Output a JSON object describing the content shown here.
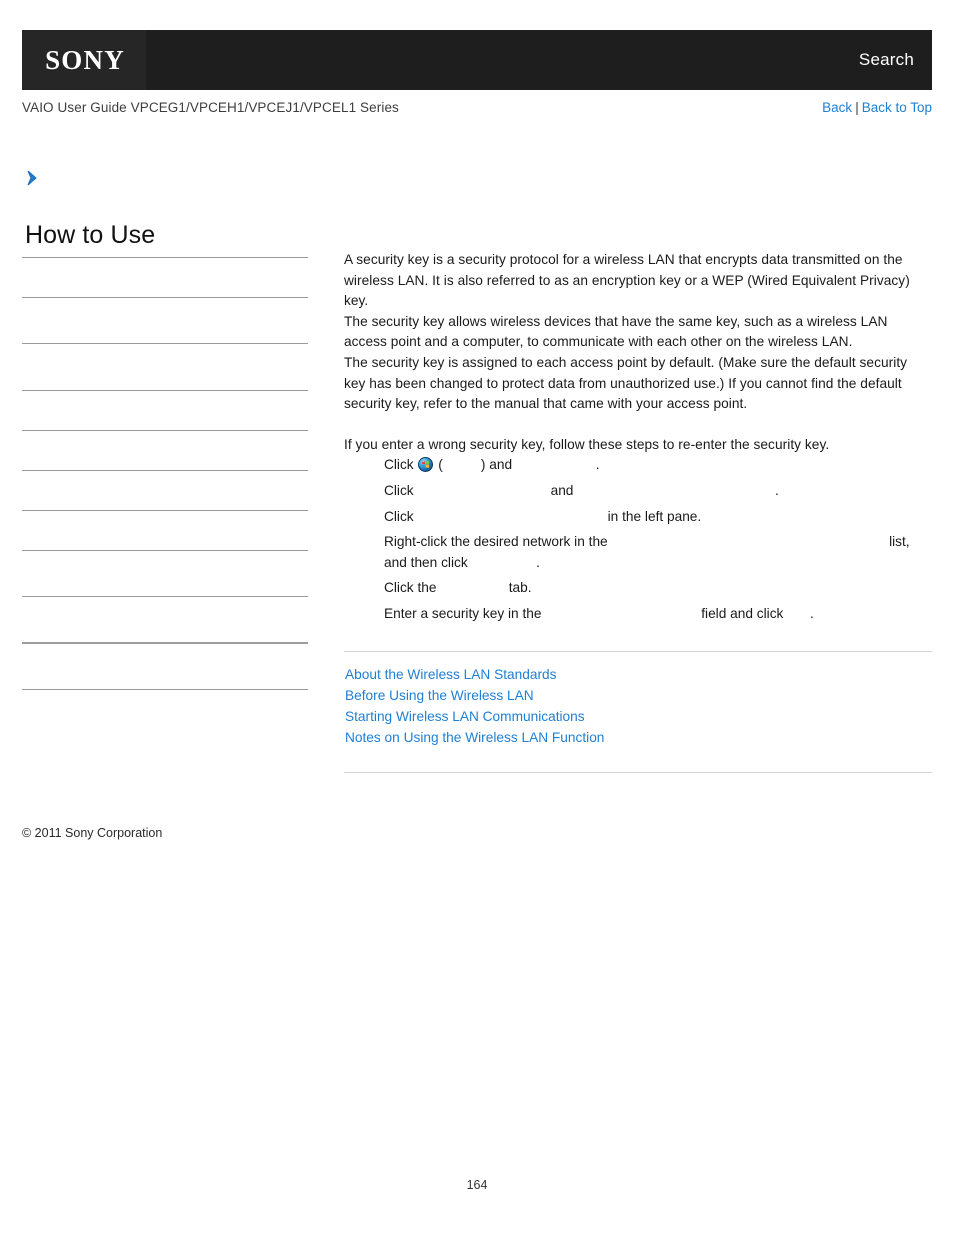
{
  "header": {
    "logo_text": "SONY",
    "search_label": "Search"
  },
  "subnav": {
    "title": "VAIO User Guide VPCEG1/VPCEH1/VPCEJ1/VPCEL1 Series",
    "back_label": "Back",
    "separator": "|",
    "back_to_top_label": "Back to Top"
  },
  "sidebar": {
    "expand_icon": "chevron-right-icon",
    "heading": "How to Use",
    "items": [
      {
        "label": ""
      },
      {
        "label": ""
      },
      {
        "label": ""
      },
      {
        "label": ""
      },
      {
        "label": ""
      },
      {
        "label": ""
      },
      {
        "label": ""
      },
      {
        "label": ""
      },
      {
        "label": ""
      },
      {
        "label": ""
      },
      {
        "label": ""
      }
    ]
  },
  "content": {
    "paragraphs": [
      "A security key is a security protocol for a wireless LAN that encrypts data transmitted on the wireless LAN. It is also referred to as an encryption key or a WEP (Wired Equivalent Privacy) key.",
      "The security key allows wireless devices that have the same key, such as a wireless LAN access point and a computer, to communicate with each other on the wireless LAN.",
      "The security key is assigned to each access point by default. (Make sure the default security key has been changed to protect data from unauthorized use.) If you cannot find the default security key, refer to the manual that came with your access point."
    ],
    "steps_lead": "If you enter a wrong security key, follow these steps to re-enter the security key.",
    "steps": [
      {
        "pre": "Click ",
        "icon": "windows-start-orb-icon",
        "mid1": " (",
        "term1": "          ",
        "mid2": ") and ",
        "term2": "                     ",
        "post": "."
      },
      {
        "pre": "Click ",
        "term1": "                                   ",
        "mid1": "and ",
        "term2": "                                                    ",
        "post": "."
      },
      {
        "pre": "Click ",
        "term1": "                                                  ",
        "post": "in the left pane."
      },
      {
        "pre": "Right-click the desired network in the ",
        "term1": "                                                                         ",
        "mid1": "list, and then click ",
        "term2": "                 ",
        "post": "."
      },
      {
        "pre": "Click the ",
        "term1": "                  ",
        "post": "tab."
      },
      {
        "pre": "Enter a security key in the ",
        "term1": "                                         ",
        "mid1": "field and click ",
        "term2": "      ",
        "post": "."
      }
    ],
    "related_links": [
      "About the Wireless LAN Standards",
      "Before Using the Wireless LAN",
      "Starting Wireless LAN Communications",
      "Notes on Using the Wireless LAN Function"
    ]
  },
  "footer": {
    "copyright": "© 2011 Sony Corporation",
    "page_number": "164"
  }
}
